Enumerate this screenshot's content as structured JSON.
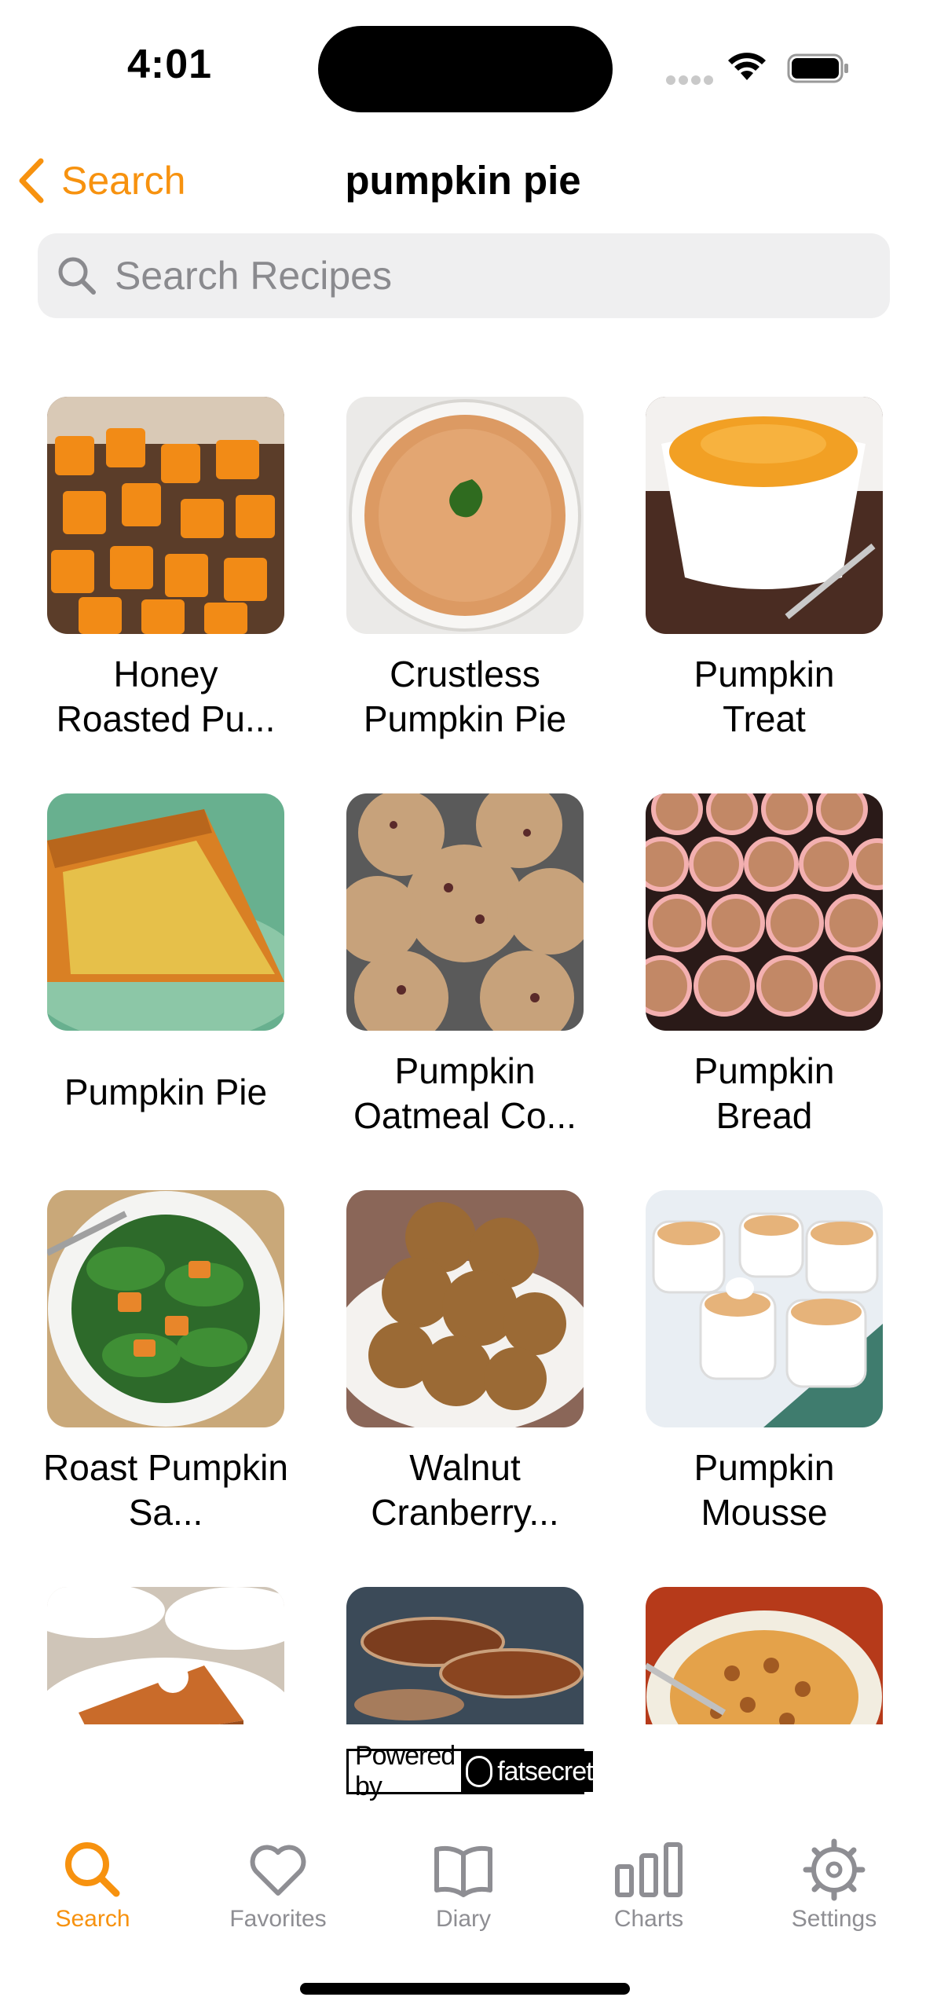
{
  "status_bar": {
    "time": "4:01"
  },
  "nav": {
    "back_label": "Search",
    "title": "pumpkin pie"
  },
  "search": {
    "placeholder": "Search Recipes",
    "value": ""
  },
  "recipes": [
    {
      "title": "Honey Roasted Pu..."
    },
    {
      "title": "Crustless Pumpkin Pie"
    },
    {
      "title": "Pumpkin Treat"
    },
    {
      "title": "Pumpkin Pie"
    },
    {
      "title": "Pumpkin Oatmeal Co..."
    },
    {
      "title": "Pumpkin Bread"
    },
    {
      "title": "Roast Pumpkin Sa..."
    },
    {
      "title": "Walnut Cranberry..."
    },
    {
      "title": "Pumpkin Mousse"
    },
    {
      "title": ""
    },
    {
      "title": ""
    },
    {
      "title": ""
    }
  ],
  "powered_by": {
    "prefix": "Powered by",
    "brand": "fatsecret"
  },
  "tabs": [
    {
      "label": "Search",
      "icon": "search-icon",
      "active": true
    },
    {
      "label": "Favorites",
      "icon": "heart-icon",
      "active": false
    },
    {
      "label": "Diary",
      "icon": "book-icon",
      "active": false
    },
    {
      "label": "Charts",
      "icon": "bar-chart-icon",
      "active": false
    },
    {
      "label": "Settings",
      "icon": "gear-icon",
      "active": false
    }
  ],
  "colors": {
    "accent": "#f7920f",
    "inactive": "#8e8e93",
    "search_bg": "#efeff0"
  }
}
